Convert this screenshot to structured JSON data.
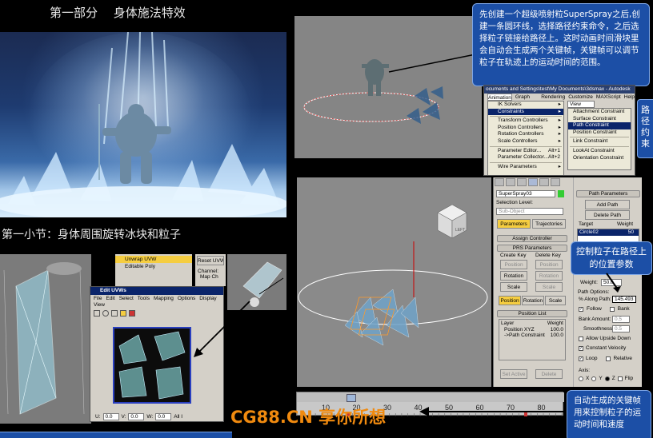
{
  "part_title": "第一部分　 身体施法特效",
  "section_title": "第一小节：身体周围旋转冰块和粒子",
  "callout_top": "先创建一个超级喷射粒SuperSpray之后,创建一条圆环线，选择路径约束命令，之后选择粒子链接给路径上。这时动画时间滑块里会自动会生成两个关键帧，关键帧可以调节粒子在轨迹上的运动时间的范围。",
  "callout_side": "路径约束",
  "callout_mid": "控制粒子在路径上的位置参数",
  "callout_bottom": "自动生成的关键帧用来控制粒子的运动时间和速度",
  "watermark": "CG88.CN 享你所想",
  "max_window": {
    "title": "ocuments and Settings\\test\\My Documents\\3dsmax - Autodesk",
    "menubar": [
      "Animation",
      "Graph Editors",
      "Rendering",
      "Customize",
      "MAXScript",
      "Help"
    ],
    "view_label": "View"
  },
  "animation_menu": [
    {
      "label": "IK Solvers",
      "arrow": true
    },
    {
      "label": "Constraints",
      "arrow": true,
      "selected": true
    },
    {
      "label": "Transform Controllers",
      "arrow": true
    },
    {
      "label": "Position Controllers",
      "arrow": true
    },
    {
      "label": "Rotation Controllers",
      "arrow": true
    },
    {
      "label": "Scale Controllers",
      "arrow": true
    },
    {
      "label": "Parameter Editor...",
      "shortcut": "Alt+1"
    },
    {
      "label": "Parameter Collector...",
      "shortcut": "Alt+2"
    },
    {
      "label": "Wire Parameters",
      "arrow": true
    }
  ],
  "constraints_submenu": [
    {
      "label": "Attachment Constraint"
    },
    {
      "label": "Surface Constraint"
    },
    {
      "label": "Path Constraint",
      "selected": true
    },
    {
      "label": "Position Constraint"
    },
    {
      "label": "Link Constraint"
    },
    {
      "label": "LookAt Constraint"
    },
    {
      "label": "Orientation Constraint"
    }
  ],
  "motion_panel": {
    "object_name": "SuperSpray03",
    "selection_level_label": "Selection Level:",
    "sub_object": "Sub-Object",
    "tab_parameters": "Parameters",
    "tab_trajectories": "Trajectories",
    "assign_controller": "Assign Controller",
    "prs_parameters": "PRS Parameters",
    "create_key": "Create Key",
    "delete_key": "Delete Key",
    "btn_position": "Position",
    "btn_rotation": "Rotation",
    "btn_scale": "Scale",
    "position_list": "Position List",
    "layer_col": "Layer",
    "weight_col": "Weight",
    "list_rows": [
      {
        "name": "Position XYZ",
        "weight": "100.0"
      },
      {
        "name": "->Path Constraint",
        "weight": "100.0"
      }
    ],
    "set_active": "Set Active",
    "delete": "Delete"
  },
  "path_panel": {
    "title": "Path Parameters",
    "add_path": "Add Path",
    "delete_path": "Delete Path",
    "target_label": "Target",
    "weight_label": "Weight",
    "target_value": "Circle02",
    "target_weight": "50",
    "weight_field_label": "Weight:",
    "weight_field_value": "50.0",
    "path_options_label": "Path Options:",
    "along_path_label": "% Along Path:",
    "along_path_value": "145.493",
    "follow_label": "Follow",
    "bank_label": "Bank",
    "bank_amount_label": "Bank Amount:",
    "bank_amount_value": "0.5",
    "smoothness_label": "Smoothness:",
    "smoothness_value": "0.5",
    "allow_upside_label": "Allow Upside Down",
    "constant_velocity_label": "Constant Velocity",
    "loop_label": "Loop",
    "relative_label": "Relative",
    "axis_label": "Axis:",
    "axis_x": "X",
    "axis_y": "Y",
    "axis_z": "Z",
    "flip_label": "Flip"
  },
  "timeline_ticks": [
    "10",
    "20",
    "30",
    "40",
    "50",
    "60",
    "70",
    "80"
  ],
  "modifier_stack": {
    "unwrap": "Unwrap UVW",
    "editable_poly": "Editable Poly",
    "reset_uvw": "Reset UVW",
    "channel": "Channel:",
    "map_channel": "Map Ch"
  },
  "edit_uvw": {
    "title": "Edit UVWs",
    "menus": [
      "File",
      "Edit",
      "Select",
      "Tools",
      "Mapping",
      "Options",
      "Display"
    ],
    "view_menu": "View",
    "footer_u": "U:",
    "footer_v": "V:",
    "footer_w": "W:",
    "footer_u_val": "0.0",
    "footer_v_val": "0.0",
    "footer_w_val": "0.0",
    "footer_all": "All I"
  },
  "viewcube_label": "LEFT"
}
